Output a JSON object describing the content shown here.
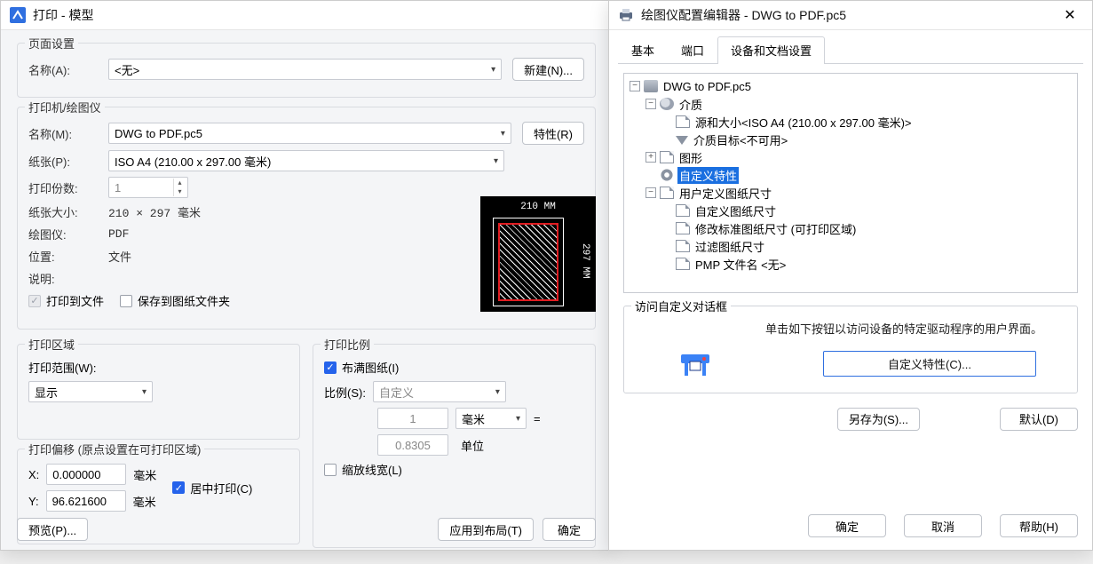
{
  "win1": {
    "title": "打印 - 模型",
    "page_setup": {
      "legend": "页面设置",
      "name_label": "名称(A):",
      "name_value": "<无>",
      "new_btn": "新建(N)..."
    },
    "printer": {
      "legend": "打印机/绘图仪",
      "name_label": "名称(M):",
      "name_value": "DWG to PDF.pc5",
      "props_btn": "特性(R)",
      "paper_label": "纸张(P):",
      "paper_value": "ISO A4 (210.00 x 297.00 毫米)",
      "copies_label": "打印份数:",
      "copies_value": "1",
      "size_label": "纸张大小:",
      "size_value": "210 × 297  毫米",
      "plotter_label": "绘图仪:",
      "plotter_value": "PDF",
      "where_label": "位置:",
      "where_value": "文件",
      "desc_label": "说明:",
      "to_file": "打印到文件",
      "save_paper": "保存到图纸文件夹"
    },
    "preview": {
      "top": "210 MM",
      "right": "297 MM"
    },
    "area": {
      "legend": "打印区域",
      "range_label": "打印范围(W):",
      "range_value": "显示"
    },
    "scale": {
      "legend": "打印比例",
      "fit": "布满图纸(I)",
      "scale_label": "比例(S):",
      "scale_value": "自定义",
      "num1": "1",
      "unit1": "毫米",
      "eq": "=",
      "num2": "0.8305",
      "unit2": "单位",
      "scale_lw": "缩放线宽(L)"
    },
    "offset": {
      "legend": "打印偏移 (原点设置在可打印区域)",
      "x_label": "X:",
      "x_value": "0.000000",
      "x_unit": "毫米",
      "y_label": "Y:",
      "y_value": "96.621600",
      "y_unit": "毫米",
      "center": "居中打印(C)"
    },
    "footer": {
      "preview": "预览(P)...",
      "apply": "应用到布局(T)",
      "ok": "确定"
    }
  },
  "win2": {
    "title": "绘图仪配置编辑器 - DWG to PDF.pc5",
    "tabs": [
      "基本",
      "端口",
      "设备和文档设置"
    ],
    "tree": [
      {
        "ind": 0,
        "tw": "-",
        "icon": "printer",
        "lbl": "DWG to PDF.pc5"
      },
      {
        "ind": 1,
        "tw": "-",
        "icon": "media",
        "lbl": "介质"
      },
      {
        "ind": 2,
        "tw": " ",
        "icon": "page",
        "lbl": "源和大小<ISO A4 (210.00 x 297.00 毫米)>"
      },
      {
        "ind": 2,
        "tw": " ",
        "icon": "filter",
        "lbl": "介质目标<不可用>"
      },
      {
        "ind": 1,
        "tw": "+",
        "icon": "page",
        "lbl": "图形"
      },
      {
        "ind": 1,
        "tw": " ",
        "icon": "gear",
        "lbl": "自定义特性",
        "sel": true
      },
      {
        "ind": 1,
        "tw": "-",
        "icon": "page",
        "lbl": "用户定义图纸尺寸"
      },
      {
        "ind": 2,
        "tw": " ",
        "icon": "page",
        "lbl": "自定义图纸尺寸"
      },
      {
        "ind": 2,
        "tw": " ",
        "icon": "page",
        "lbl": "修改标准图纸尺寸 (可打印区域)"
      },
      {
        "ind": 2,
        "tw": " ",
        "icon": "page",
        "lbl": "过滤图纸尺寸"
      },
      {
        "ind": 2,
        "tw": " ",
        "icon": "page",
        "lbl": "PMP 文件名 <无>"
      }
    ],
    "group": {
      "legend": "访问自定义对话框",
      "desc": "单击如下按钮以访问设备的特定驱动程序的用户界面。",
      "btn": "自定义特性(C)..."
    },
    "footer_a": {
      "saveas": "另存为(S)...",
      "default": "默认(D)"
    },
    "footer_b": {
      "ok": "确定",
      "cancel": "取消",
      "help": "帮助(H)"
    }
  }
}
